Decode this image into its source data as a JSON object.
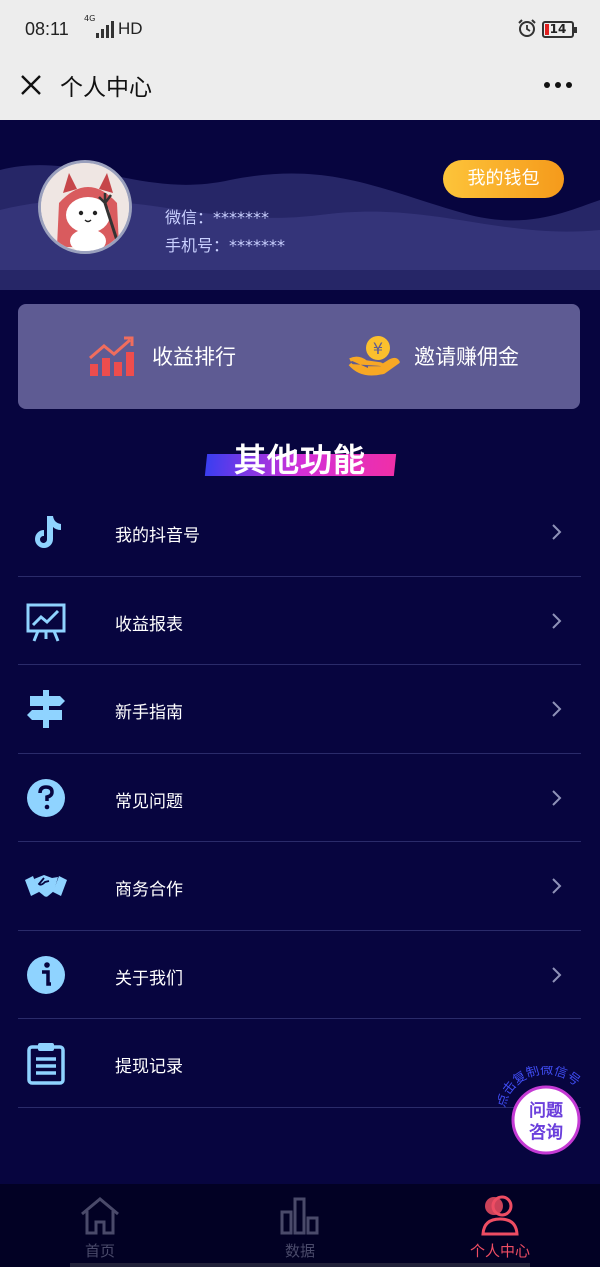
{
  "status_bar": {
    "time": "08:11",
    "network": "4G",
    "hd": "HD",
    "battery": "14"
  },
  "title_bar": {
    "title": "个人中心",
    "close_icon": "close-icon",
    "more_icon": "more-icon"
  },
  "profile": {
    "wechat": "微信：*******",
    "phone": "手机号：*******",
    "wallet_label": "我的钱包"
  },
  "quick_actions": [
    {
      "label": "收益排行",
      "icon": "rising-chart-icon"
    },
    {
      "label": "邀请赚佣金",
      "icon": "yuan-hand-icon"
    }
  ],
  "section_title": "其他功能",
  "menu": [
    {
      "label": "我的抖音号",
      "icon": "tiktok-icon"
    },
    {
      "label": "收益报表",
      "icon": "report-icon"
    },
    {
      "label": "新手指南",
      "icon": "signpost-icon"
    },
    {
      "label": "常见问题",
      "icon": "question-icon"
    },
    {
      "label": "商务合作",
      "icon": "handshake-icon"
    },
    {
      "label": "关于我们",
      "icon": "info-icon"
    },
    {
      "label": "提现记录",
      "icon": "clipboard-icon"
    }
  ],
  "floating_help": {
    "line1": "问题",
    "line2": "咨询",
    "arc_text": "点击复制微信号"
  },
  "bottom_nav": [
    {
      "label": "首页",
      "icon": "home-icon",
      "active": false
    },
    {
      "label": "数据",
      "icon": "bar-chart-icon",
      "active": false
    },
    {
      "label": "个人中心",
      "icon": "user-icon",
      "active": true
    }
  ],
  "colors": {
    "background": "#07053f",
    "accent_gold": "#fdc43a",
    "active_nav": "#ee4d63",
    "menu_icon": "#8fd3ff"
  }
}
